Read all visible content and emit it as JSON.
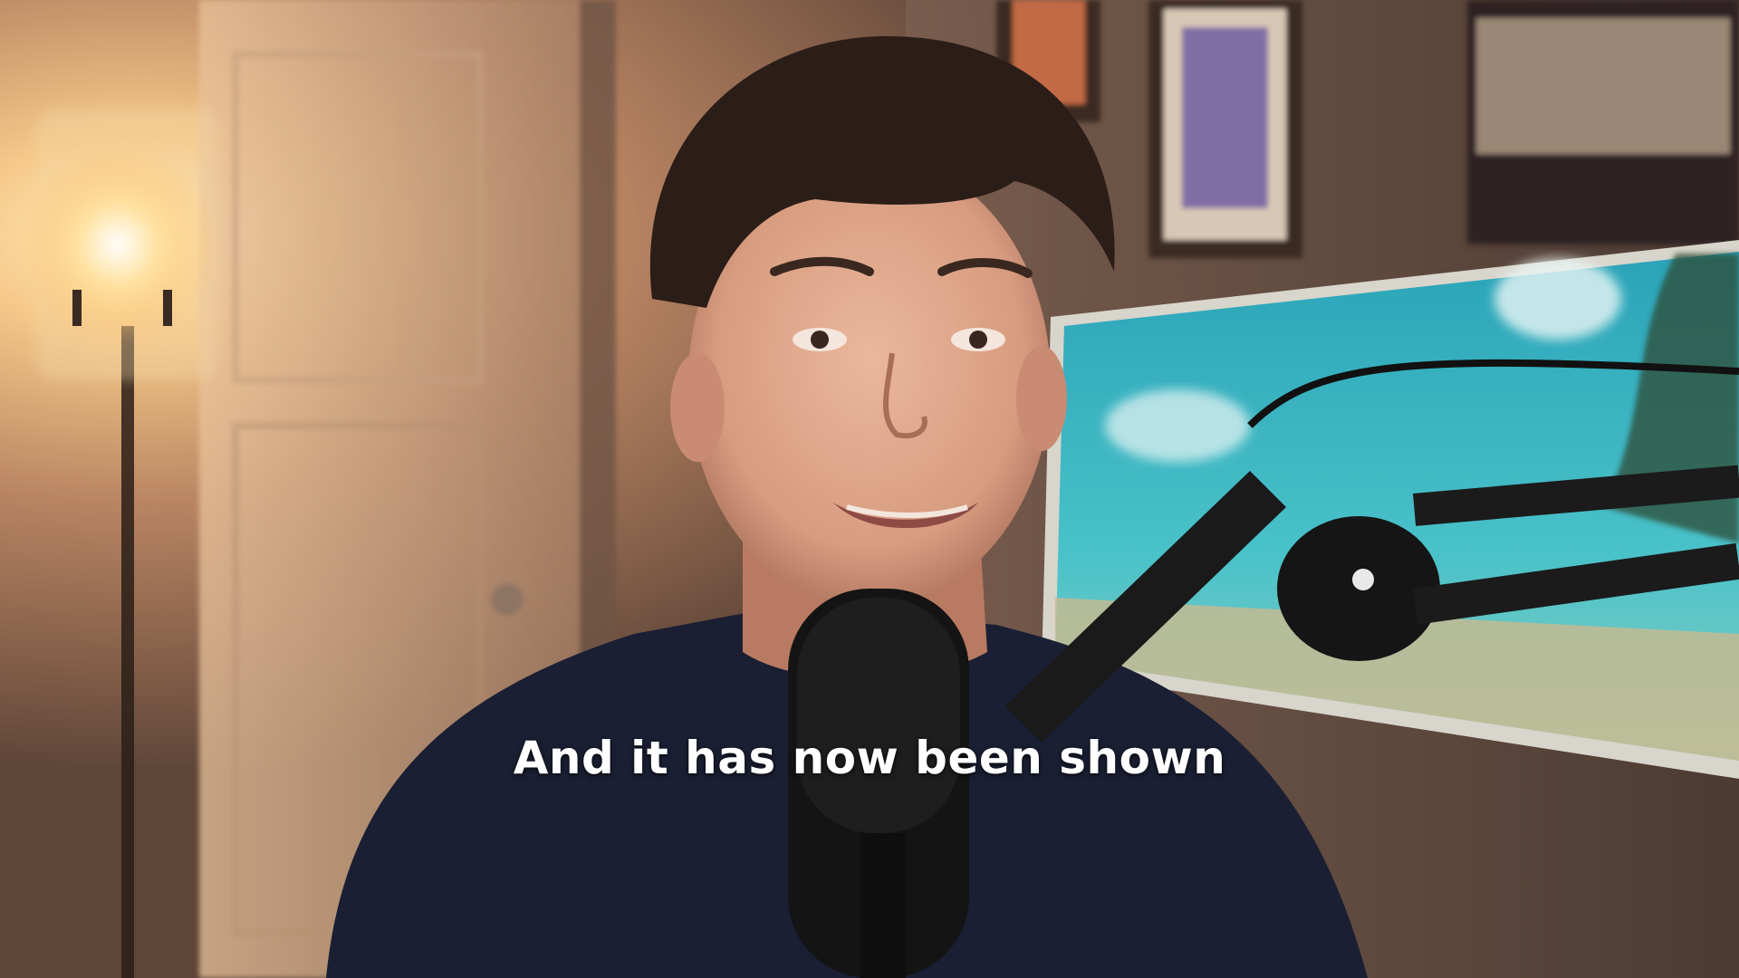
{
  "video": {
    "subtitle": "And it has now been shown"
  },
  "scene": {
    "subjects": [
      "person-speaking",
      "podcast-microphone",
      "floor-lamp",
      "framed-pictures",
      "tropical-monitor"
    ],
    "colors": {
      "warm_light": "#f7c98a",
      "wall": "#8a6a55",
      "shirt": "#1a1f33",
      "hair": "#2b1d17",
      "skin": "#e0ad92",
      "monitor_sky": "#3fb8c8",
      "mic": "#141414"
    }
  }
}
